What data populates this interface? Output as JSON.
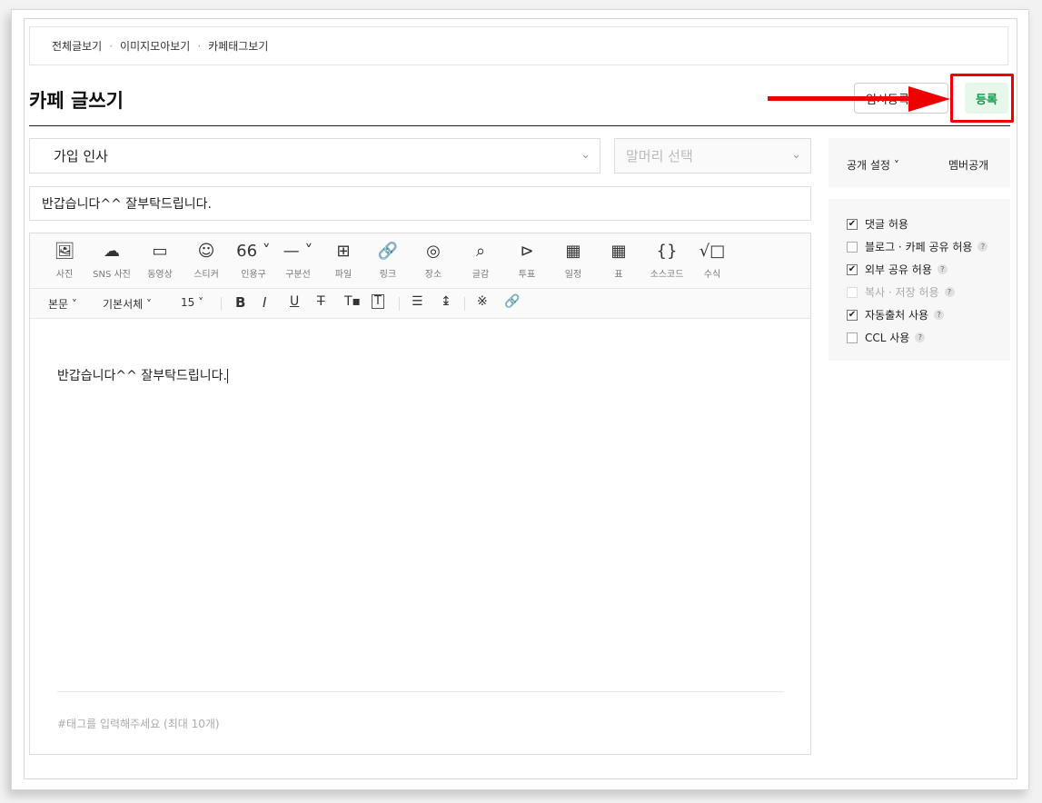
{
  "breadcrumb": {
    "items": [
      "전체글보기",
      "이미지모아보기",
      "카페태그보기"
    ],
    "sep": "·"
  },
  "header": {
    "title": "카페 글쓰기",
    "temp_save_label": "임시등록",
    "register_label": "등록"
  },
  "form": {
    "board_select": "가입 인사",
    "head_select_placeholder": "말머리 선택",
    "subject": "반갑습니다^^ 잘부탁드립니다."
  },
  "toolbar": [
    {
      "icon": "image-icon",
      "glyph": "🖼",
      "label": "사진"
    },
    {
      "icon": "cloud-upload-icon",
      "glyph": "☁",
      "label": "SNS 사진"
    },
    {
      "icon": "video-icon",
      "glyph": "▭",
      "label": "동영상"
    },
    {
      "icon": "smiley-icon",
      "glyph": "☺",
      "label": "스티커"
    },
    {
      "icon": "quote-icon",
      "glyph": "66 ˅",
      "label": "인용구"
    },
    {
      "icon": "divider-icon",
      "glyph": "— ˅",
      "label": "구분선"
    },
    {
      "icon": "file-icon",
      "glyph": "⊞",
      "label": "파일"
    },
    {
      "icon": "link-icon",
      "glyph": "🔗",
      "label": "링크"
    },
    {
      "icon": "map-pin-icon",
      "glyph": "◎",
      "label": "장소"
    },
    {
      "icon": "search-text-icon",
      "glyph": "⌕",
      "label": "글감"
    },
    {
      "icon": "vote-icon",
      "glyph": "⊳",
      "label": "투표"
    },
    {
      "icon": "calendar-icon",
      "glyph": "▦",
      "label": "일정"
    },
    {
      "icon": "table-icon",
      "glyph": "▦",
      "label": "표"
    },
    {
      "icon": "code-icon",
      "glyph": "{}",
      "label": "소스코드"
    },
    {
      "icon": "formula-icon",
      "glyph": "√□",
      "label": "수식"
    }
  ],
  "format_bar": {
    "paragraph": "본문",
    "font": "기본서체",
    "size": "15"
  },
  "content": {
    "body": "반갑습니다^^ 잘부탁드립니다.",
    "tag_placeholder": "#태그를 입력해주세요 (최대 10개)"
  },
  "settings": {
    "visibility_label": "공개 설정",
    "visibility_value": "멤버공개",
    "options": [
      {
        "label": "댓글 허용",
        "checked": true,
        "help": false,
        "disabled": false
      },
      {
        "label": "블로그 · 카페 공유 허용",
        "checked": false,
        "help": true,
        "disabled": false
      },
      {
        "label": "외부 공유 허용",
        "checked": true,
        "help": true,
        "disabled": false
      },
      {
        "label": "복사 · 저장 허용",
        "checked": false,
        "help": true,
        "disabled": true
      },
      {
        "label": "자동출처 사용",
        "checked": true,
        "help": true,
        "disabled": false
      },
      {
        "label": "CCL 사용",
        "checked": false,
        "help": true,
        "disabled": false
      }
    ]
  },
  "colors": {
    "accent_green": "#0a9d45",
    "annotation_red": "#e00000"
  }
}
